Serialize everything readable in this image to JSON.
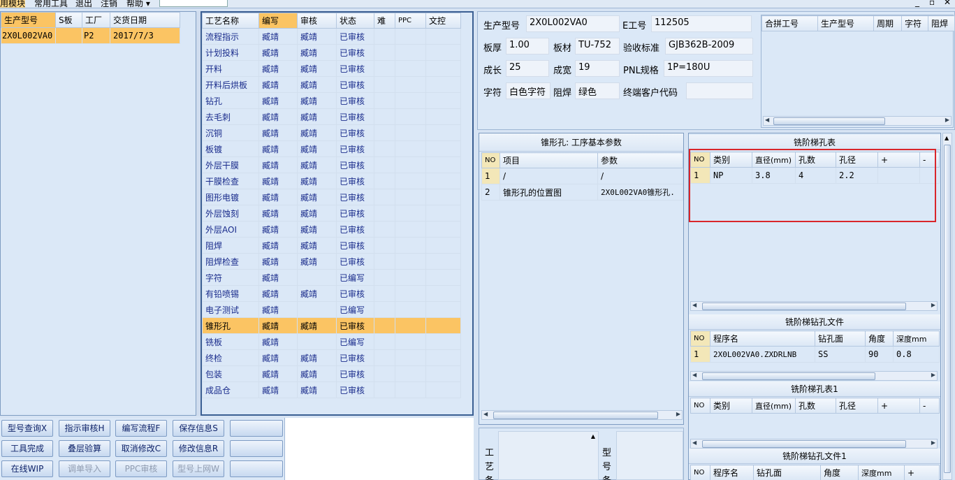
{
  "menu": {
    "items": [
      "用模块",
      "常用工具",
      "退出",
      "注销",
      "帮助 ▾"
    ]
  },
  "window_controls": [
    "_",
    "▫",
    "✕"
  ],
  "left_list": {
    "headers": [
      "生产型号",
      "S板",
      "工厂",
      "交货日期"
    ],
    "rows": [
      [
        "2X0L002VA0",
        "",
        "P2",
        "2017/7/3"
      ]
    ]
  },
  "process_table": {
    "headers": [
      "工艺名称",
      "编写",
      "审核",
      "状态",
      "难",
      "PPC",
      "文控"
    ],
    "rows": [
      [
        "流程指示",
        "臧靖",
        "臧靖",
        "已审核"
      ],
      [
        "计划投料",
        "臧靖",
        "臧靖",
        "已审核"
      ],
      [
        "开料",
        "臧靖",
        "臧靖",
        "已审核"
      ],
      [
        "开料后烘板",
        "臧靖",
        "臧靖",
        "已审核"
      ],
      [
        "钻孔",
        "臧靖",
        "臧靖",
        "已审核"
      ],
      [
        "去毛刺",
        "臧靖",
        "臧靖",
        "已审核"
      ],
      [
        "沉铜",
        "臧靖",
        "臧靖",
        "已审核"
      ],
      [
        "板镀",
        "臧靖",
        "臧靖",
        "已审核"
      ],
      [
        "外层干膜",
        "臧靖",
        "臧靖",
        "已审核"
      ],
      [
        "干膜检查",
        "臧靖",
        "臧靖",
        "已审核"
      ],
      [
        "图形电镀",
        "臧靖",
        "臧靖",
        "已审核"
      ],
      [
        "外层蚀刻",
        "臧靖",
        "臧靖",
        "已审核"
      ],
      [
        "外层AOI",
        "臧靖",
        "臧靖",
        "已审核"
      ],
      [
        "阻焊",
        "臧靖",
        "臧靖",
        "已审核"
      ],
      [
        "阻焊检查",
        "臧靖",
        "臧靖",
        "已审核"
      ],
      [
        "字符",
        "臧靖",
        "",
        "已编写"
      ],
      [
        "有铅喷锡",
        "臧靖",
        "臧靖",
        "已审核"
      ],
      [
        "电子测试",
        "臧靖",
        "",
        "已编写"
      ],
      [
        "锥形孔",
        "臧靖",
        "臧靖",
        "已审核"
      ],
      [
        "铣板",
        "臧靖",
        "",
        "已编写"
      ],
      [
        "终检",
        "臧靖",
        "臧靖",
        "已审核"
      ],
      [
        "包装",
        "臧靖",
        "臧靖",
        "已审核"
      ],
      [
        "成品仓",
        "臧靖",
        "臧靖",
        "已审核"
      ]
    ],
    "selected_row": 18
  },
  "info": {
    "model_label": "生产型号",
    "model_value": "2X0L002VA0",
    "e_label": "E工号",
    "e_value": "112505",
    "thick_label": "板厚",
    "thick_value": "1.00",
    "mat_label": "板材",
    "mat_value": "TU-752",
    "std_label": "验收标准",
    "std_value": "GJB362B-2009",
    "len_label": "成长",
    "len_value": "25",
    "wid_label": "成宽",
    "wid_value": "19",
    "pnl_label": "PNL规格",
    "pnl_value": "1P=180U",
    "char_label": "字符",
    "char_value": "白色字符",
    "mask_label": "阻焊",
    "mask_value": "绿色",
    "cust_label": "终端客户代码",
    "cust_value": ""
  },
  "combine_table": {
    "headers": [
      "合拼工号",
      "生产型号",
      "周期",
      "字符",
      "阻焊"
    ]
  },
  "param_panel": {
    "title": "锥形孔: 工序基本参数",
    "headers": [
      "NO",
      "项目",
      "参数"
    ],
    "rows": [
      [
        "1",
        "/",
        "/"
      ],
      [
        "2",
        "锥形孔的位置图",
        "2X0L002VA0锥形孔."
      ]
    ]
  },
  "hole_table": {
    "title": "铣阶梯孔表",
    "headers": [
      "NO",
      "类别",
      "直径(mm)",
      "孔数",
      "孔径",
      "+",
      "-"
    ],
    "rows": [
      [
        "1",
        "NP",
        "3.8",
        "4",
        "2.2",
        "",
        ""
      ]
    ]
  },
  "drill_file": {
    "title": "铣阶梯钻孔文件",
    "headers": [
      "NO",
      "程序名",
      "钻孔面",
      "角度",
      "深度mm"
    ],
    "rows": [
      [
        "1",
        "2X0L002VA0.ZXDRLNB",
        "SS",
        "90",
        "0.8"
      ]
    ]
  },
  "hole_table1": {
    "title": "铣阶梯孔表1",
    "headers": [
      "NO",
      "类别",
      "直径(mm)",
      "孔数",
      "孔径",
      "+",
      "-"
    ]
  },
  "drill_file1": {
    "title": "铣阶梯钻孔文件1",
    "headers": [
      "NO",
      "程序名",
      "钻孔面",
      "角度",
      "深度mm",
      "+"
    ]
  },
  "bottom_labels": {
    "left": [
      "工",
      "艺",
      "备"
    ],
    "right": [
      "型",
      "号",
      "备"
    ]
  },
  "buttons": [
    {
      "label": "型号查询X",
      "enabled": true
    },
    {
      "label": "指示审核H",
      "enabled": true
    },
    {
      "label": "编写流程F",
      "enabled": true
    },
    {
      "label": "保存信息S",
      "enabled": true
    },
    {
      "label": "",
      "enabled": true
    },
    {
      "label": "工具完成",
      "enabled": true
    },
    {
      "label": "叠层验算",
      "enabled": true
    },
    {
      "label": "取消修改C",
      "enabled": true
    },
    {
      "label": "修改信息R",
      "enabled": true
    },
    {
      "label": "",
      "enabled": true
    },
    {
      "label": "在线WIP",
      "enabled": true
    },
    {
      "label": "调单导入",
      "enabled": false
    },
    {
      "label": "PPC审核",
      "enabled": false
    },
    {
      "label": "型号上网W",
      "enabled": false
    },
    {
      "label": "",
      "enabled": true
    }
  ]
}
